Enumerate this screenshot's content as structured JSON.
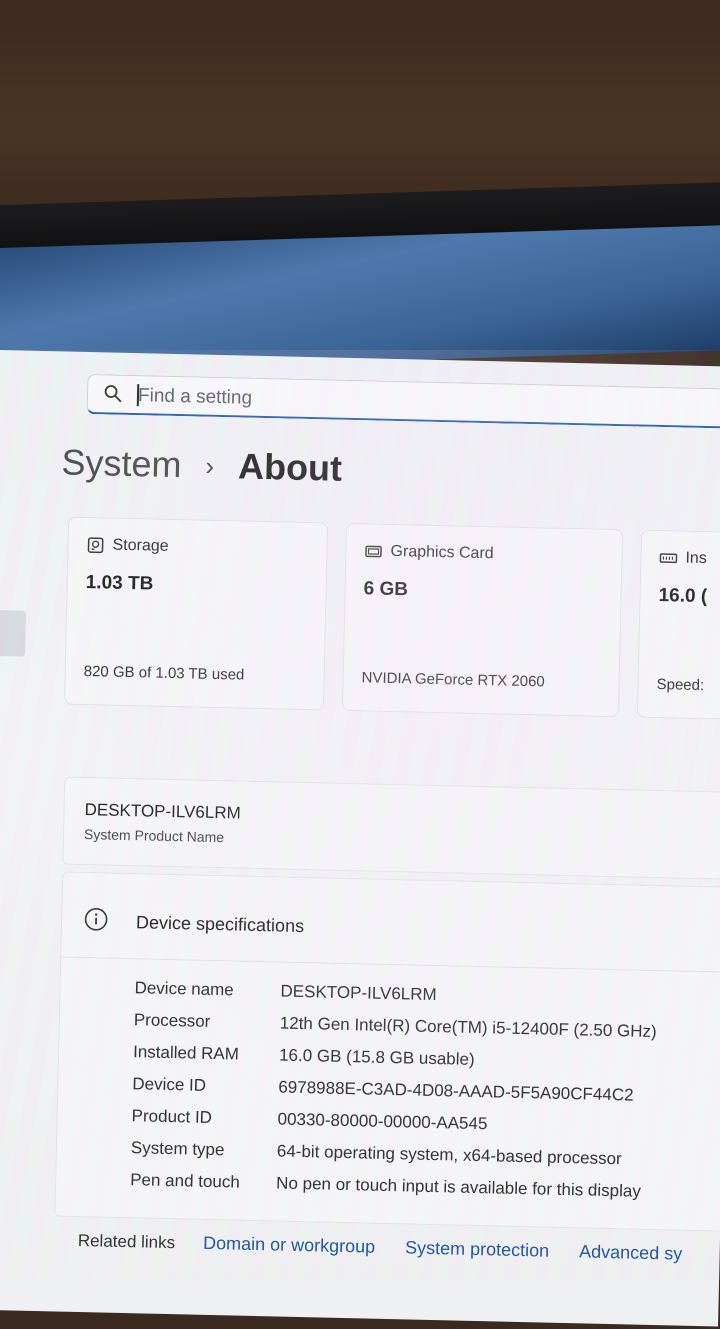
{
  "search": {
    "placeholder": "Find a setting"
  },
  "breadcrumb": {
    "parent": "System",
    "separator": "›",
    "current": "About"
  },
  "cards": [
    {
      "icon": "storage-icon",
      "title": "Storage",
      "value": "1.03 TB",
      "sub": "820 GB of 1.03 TB used"
    },
    {
      "icon": "graphics-card-icon",
      "title": "Graphics Card",
      "value": "6 GB",
      "sub": "NVIDIA GeForce RTX 2060"
    },
    {
      "icon": "memory-icon",
      "title": "Ins",
      "value": "16.0 (",
      "sub": "Speed:"
    }
  ],
  "product": {
    "name": "DESKTOP-ILV6LRM",
    "label": "System Product Name"
  },
  "device_specs": {
    "title": "Device specifications",
    "rows": [
      {
        "key": "Device name",
        "value": "DESKTOP-ILV6LRM"
      },
      {
        "key": "Processor",
        "value": "12th Gen Intel(R) Core(TM) i5-12400F (2.50 GHz)"
      },
      {
        "key": "Installed RAM",
        "value": "16.0 GB (15.8 GB usable)"
      },
      {
        "key": "Device ID",
        "value": "6978988E-C3AD-4D08-AAAD-5F5A90CF44C2"
      },
      {
        "key": "Product ID",
        "value": "00330-80000-00000-AA545"
      },
      {
        "key": "System type",
        "value": "64-bit operating system, x64-based processor"
      },
      {
        "key": "Pen and touch",
        "value": "No pen or touch input is available for this display"
      }
    ]
  },
  "related": {
    "label": "Related links",
    "links": [
      "Domain or workgroup",
      "System protection",
      "Advanced sy"
    ]
  }
}
